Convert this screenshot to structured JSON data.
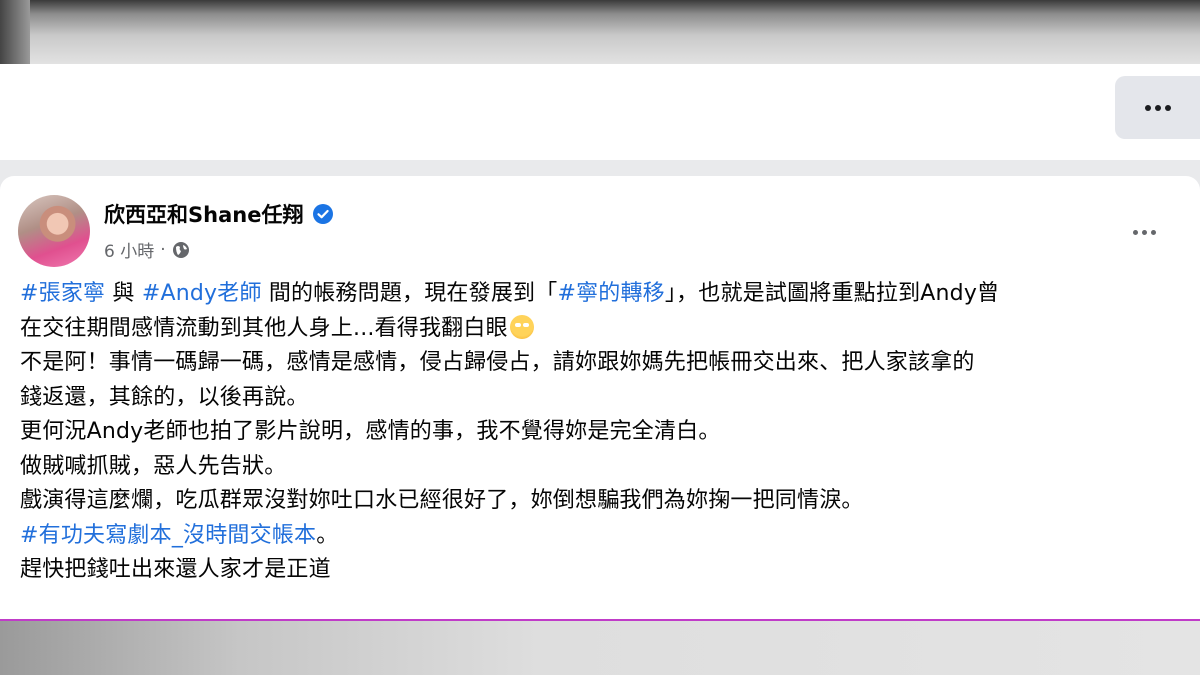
{
  "post": {
    "author": "欣西亞和Shane任翔",
    "time": "6 小時",
    "dot_separator": "·",
    "lines": [
      [
        {
          "text": "#張家寧",
          "tag": true
        },
        {
          "text": " 與 ",
          "tag": false
        },
        {
          "text": "#Andy老師",
          "tag": true
        },
        {
          "text": " 間的帳務問題，現在發展到「",
          "tag": false
        },
        {
          "text": "#寧的轉移",
          "tag": true
        },
        {
          "text": "」，也就是試圖將重點拉到Andy曾",
          "tag": false
        }
      ],
      [
        {
          "text": "在交往期間感情流動到其他人身上...看得我翻白眼",
          "tag": false
        }
      ],
      [
        {
          "text": "不是阿！事情一碼歸一碼，感情是感情，侵占歸侵占，請妳跟妳媽先把帳冊交出來、把人家該拿的",
          "tag": false
        }
      ],
      [
        {
          "text": "錢返還，其餘的，以後再說。",
          "tag": false
        }
      ],
      [
        {
          "text": "更何況Andy老師也拍了影片說明，感情的事，我不覺得妳是完全清白。",
          "tag": false
        }
      ],
      [
        {
          "text": "做賊喊抓賊，惡人先告狀。",
          "tag": false
        }
      ],
      [
        {
          "text": "戲演得這麼爛，吃瓜群眾沒對妳吐口水已經很好了，妳倒想騙我們為妳掬一把同情淚。",
          "tag": false
        }
      ],
      [
        {
          "text": "#有功夫寫劇本_沒時間交帳本",
          "tag": true
        },
        {
          "text": "。",
          "tag": false
        }
      ],
      [
        {
          "text": "趕快把錢吐出來還人家才是正道",
          "tag": false
        }
      ]
    ],
    "emoji_line_index": 1,
    "emoji_icon": "eye-roll-emoji-icon"
  },
  "colors": {
    "hashtag": "#216fdb",
    "verified": "#1b74e4",
    "meta_text": "#65676b",
    "accent_line": "#c03cc8"
  }
}
